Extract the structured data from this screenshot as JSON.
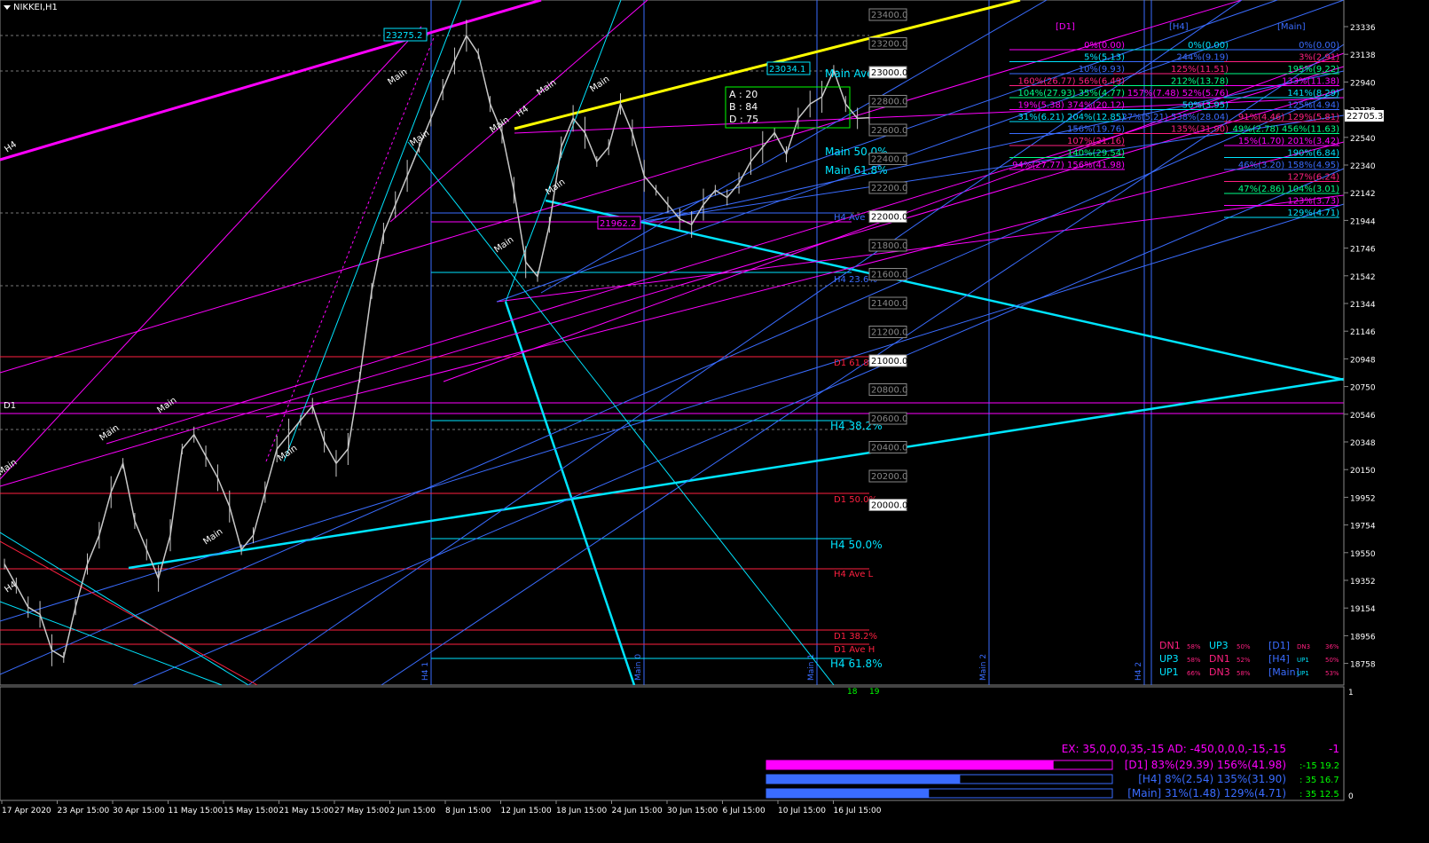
{
  "symbol": "NIKKEI,H1",
  "colors": {
    "background": "#000000",
    "candle": "#c8c8c8",
    "magenta": "#ff00ff",
    "yellow": "#ffff00",
    "cyan": "#00e5ff",
    "blue": "#3a6cff",
    "red": "#ff2040",
    "green": "#00ff00"
  },
  "chart_data": {
    "type": "line",
    "title": "NIKKEI,H1",
    "ylim": [
      18758,
      23400
    ],
    "x": [
      "17 Apr 2020",
      "23 Apr 15:00",
      "30 Apr 15:00",
      "11 May 15:00",
      "15 May 15:00",
      "21 May 15:00",
      "27 May 15:00",
      "2 Jun 15:00",
      "8 Jun 15:00",
      "12 Jun 15:00",
      "18 Jun 15:00",
      "24 Jun 15:00",
      "30 Jun 15:00",
      "6 Jul 15:00",
      "10 Jul 15:00",
      "16 Jul 15:00"
    ],
    "price_ticks": [
      "23336",
      "23138",
      "22940",
      "22738",
      "22540",
      "22340",
      "22142",
      "21944",
      "21746",
      "21542",
      "21344",
      "21146",
      "20948",
      "20750",
      "20546",
      "20348",
      "20150",
      "19952",
      "19754",
      "19550",
      "19352",
      "19154",
      "18956",
      "18758"
    ],
    "current_price": "22705.3",
    "series": [
      {
        "name": "NIKKEI,H1",
        "values": [
          19600,
          19450,
          19300,
          19250,
          19000,
          18950,
          19300,
          19600,
          19800,
          20100,
          20300,
          19900,
          19700,
          19500,
          19800,
          20400,
          20500,
          20350,
          20200,
          20000,
          19700,
          19800,
          20100,
          20400,
          20500,
          20600,
          20700,
          20450,
          20300,
          20400,
          20900,
          21500,
          21900,
          22100,
          22300,
          22500,
          22700,
          22900,
          23100,
          23275,
          23150,
          22800,
          22600,
          22200,
          21700,
          21600,
          21960,
          22500,
          22700,
          22600,
          22400,
          22500,
          22800,
          22600,
          22300,
          22200,
          22100,
          22000,
          21962,
          22100,
          22200,
          22150,
          22250,
          22400,
          22500,
          22600,
          22450,
          22700,
          22800,
          22850,
          23034,
          22800,
          22700,
          22705
        ]
      }
    ],
    "price_labels": [
      "23275.2",
      "23034.1",
      "21962.2",
      "22705.3"
    ],
    "right_level_labels": [
      "23400.0",
      "23200.0",
      "23000.0",
      "22800.0",
      "22600.0",
      "22400.0",
      "22200.0",
      "22000.0",
      "21800.0",
      "21600.0",
      "21400.0",
      "21200.0",
      "21000.0",
      "20800.0",
      "20600.0",
      "20400.0",
      "20200.0",
      "20000.0"
    ],
    "level_texts": [
      {
        "text": "Main Ave",
        "color": "#00e5ff"
      },
      {
        "text": "Main 50.0%",
        "color": "#00e5ff"
      },
      {
        "text": "Main 61.8%",
        "color": "#00e5ff"
      },
      {
        "text": "H4 38.2%",
        "color": "#00e5ff"
      },
      {
        "text": "H4 50.0%",
        "color": "#00e5ff"
      },
      {
        "text": "H4 61.8%",
        "color": "#00e5ff"
      },
      {
        "text": "H4 Ave",
        "color": "#3a6cff"
      },
      {
        "text": "H4 23.6%",
        "color": "#3a6cff"
      },
      {
        "text": "D1 61.8%",
        "color": "#ff2040"
      },
      {
        "text": "D1 50.0%",
        "color": "#ff2040"
      },
      {
        "text": "D1 38.2%",
        "color": "#ff2040"
      },
      {
        "text": "D1 Ave H",
        "color": "#ff2040"
      },
      {
        "text": "H4 Ave L",
        "color": "#ff2040"
      }
    ],
    "abd": {
      "a": "A : 20",
      "b": "B : 84",
      "d": "D : 75"
    },
    "fib_headers": [
      "[D1]",
      "[H4]",
      "[Main]"
    ],
    "fib_table": [
      [
        "0%(0.00)",
        "0%(0.00)",
        "0%(0.00)"
      ],
      [
        "5%(5.13)",
        "244%(9.19)",
        "3%(2.91)"
      ],
      [
        "10%(9.93)",
        "125%(11.51)",
        "195%(9.22)"
      ],
      [
        "160%(26.77)  56%(6.49)",
        "212%(13.78)",
        "133%(11.38)"
      ],
      [
        "104%(27.93)  35%(4.77)",
        "157%(7.48)  52%(5.76)",
        "141%(8.29)"
      ],
      [
        "19%(5.38)  374%(20.12)",
        "50%(3.95)",
        "125%(4.94)"
      ],
      [
        "31%(6.21)  204%(12.85)",
        "27%(5.21)  538%(28.04)",
        "91%(4.46)  129%(5.81)"
      ],
      [
        "156%(19.76)",
        "135%(31.90)",
        "49%(2.78)  456%(11.63)"
      ],
      [
        "107%(21.16)",
        "",
        "15%(1.70)  201%(3.42)"
      ],
      [
        "140%(29.54)",
        "",
        "190%(6.84)"
      ],
      [
        "94%(27.77)  156%(41.98)",
        "",
        "46%(3.20)  158%(4.95)"
      ],
      [
        "",
        "",
        "127%(6.24)"
      ],
      [
        "",
        "",
        "47%(2.86)  104%(3.01)"
      ],
      [
        "",
        "",
        "123%(3.73)"
      ],
      [
        "",
        "",
        "129%(4.71)"
      ]
    ],
    "dir_panel": [
      [
        "DN1",
        "58%",
        "UP3",
        "50%",
        "[D1]",
        "DN3",
        "36%"
      ],
      [
        "UP3",
        "58%",
        "DN1",
        "52%",
        "[H4]",
        "UP1",
        "50%"
      ],
      [
        "UP1",
        "66%",
        "DN3",
        "58%",
        "[Main]",
        "UP1",
        "53%"
      ]
    ],
    "sub_panel": {
      "ex_line": "EX: 35,0,0,0,35,-15   AD: -450,0,0,0,-15,-15",
      "ex_right": "-1",
      "rows": [
        {
          "label": "[D1] 83%(29.39)  156%(41.98)",
          "stat": ":-15  19.2",
          "color": "#ff00ff",
          "fill": 0.83
        },
        {
          "label": "[H4] 8%(2.54)  135%(31.90)",
          "stat": ": 35  16.7",
          "color": "#3a6cff",
          "fill": 0.56
        },
        {
          "label": "[Main] 31%(1.48)  129%(4.71)",
          "stat": ": 35  12.5",
          "color": "#3a6cff",
          "fill": 0.47
        }
      ],
      "scale_top": "1",
      "scale_bottom": "0"
    },
    "bar_counts": [
      "18",
      "19"
    ],
    "vline_labels": [
      "H4 1",
      "Main 0",
      "Main 1",
      "Main 2",
      "H4 2"
    ],
    "wave_labels": [
      "Main",
      "H4",
      "D1"
    ],
    "grid": false
  }
}
